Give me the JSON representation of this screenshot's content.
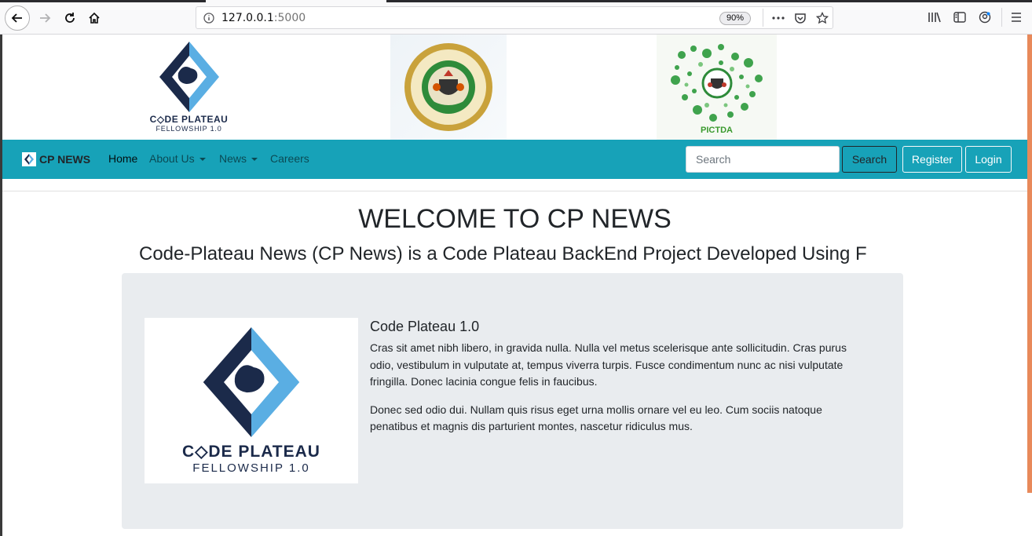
{
  "browser": {
    "url_host": "127.0.0.1",
    "url_port": ":5000",
    "zoom": "90%"
  },
  "banner": {
    "logo1_word": "C◇DE PLATEAU",
    "logo1_sub": "FELLOWSHIP 1.0",
    "logo3_caption": "PICTDA"
  },
  "navbar": {
    "brand": "CP NEWS",
    "links": [
      "Home",
      "About Us",
      "News",
      "Careers"
    ],
    "search_placeholder": "Search",
    "search_button": "Search",
    "register": "Register",
    "login": "Login"
  },
  "main": {
    "title": "WELCOME TO CP NEWS",
    "lead": "Code-Plateau News (CP News) is a Code Plateau BackEnd Project Developed Using F",
    "card": {
      "image_word": "C◇DE PLATEAU",
      "image_sub": "FELLOWSHIP 1.0",
      "heading": "Code Plateau 1.0",
      "para1": "Cras sit amet nibh libero, in gravida nulla. Nulla vel metus scelerisque ante sollicitudin. Cras purus odio, vestibulum in vulputate at, tempus viverra turpis. Fusce condimentum nunc ac nisi vulputate fringilla. Donec lacinia congue felis in faucibus.",
      "para2": "Donec sed odio dui. Nullam quis risus eget urna mollis ornare vel eu leo. Cum sociis natoque penatibus et magnis dis parturient montes, nascetur ridiculus mus."
    }
  },
  "colors": {
    "navbar": "#17a2b8",
    "jumbotron": "#e9ecef",
    "logo_dark": "#1b2a4a",
    "logo_light": "#5aaee3"
  }
}
